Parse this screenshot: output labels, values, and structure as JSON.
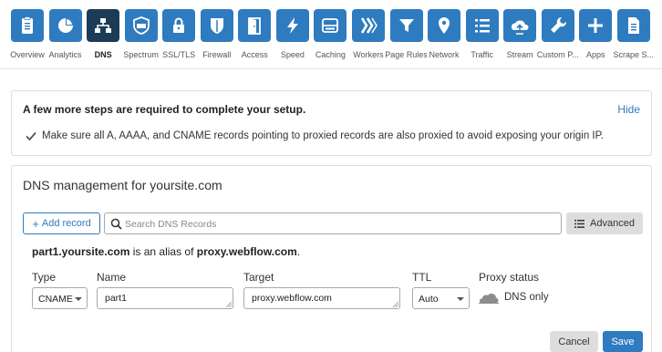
{
  "nav": {
    "active_index": 2,
    "items": [
      {
        "label": "Overview",
        "icon": "clipboard-icon"
      },
      {
        "label": "Analytics",
        "icon": "pie-chart-icon"
      },
      {
        "label": "DNS",
        "icon": "network-icon"
      },
      {
        "label": "Spectrum",
        "icon": "shield-card-icon"
      },
      {
        "label": "SSL/TLS",
        "icon": "lock-icon"
      },
      {
        "label": "Firewall",
        "icon": "firewall-shield-icon"
      },
      {
        "label": "Access",
        "icon": "door-icon"
      },
      {
        "label": "Speed",
        "icon": "lightning-icon"
      },
      {
        "label": "Caching",
        "icon": "server-icon"
      },
      {
        "label": "Workers",
        "icon": "workers-chevrons-icon"
      },
      {
        "label": "Page Rules",
        "icon": "filter-icon"
      },
      {
        "label": "Network",
        "icon": "location-pin-icon"
      },
      {
        "label": "Traffic",
        "icon": "list-icon"
      },
      {
        "label": "Stream",
        "icon": "cloud-upload-icon"
      },
      {
        "label": "Custom P...",
        "icon": "wrench-icon"
      },
      {
        "label": "Apps",
        "icon": "plus-icon"
      },
      {
        "label": "Scrape S...",
        "icon": "document-icon"
      }
    ]
  },
  "setup": {
    "title": "A few more steps are required to complete your setup.",
    "hide_label": "Hide",
    "message": "Make sure all A, AAAA, and CNAME records pointing to proxied records are also proxied to avoid exposing your origin IP."
  },
  "dns": {
    "title": "DNS management for yoursite.com",
    "add_record_label": "Add record",
    "search_placeholder": "Search DNS Records",
    "advanced_label": "Advanced",
    "alias": {
      "host": "part1.yoursite.com",
      "middle": " is an alias of ",
      "target": "proxy.webflow.com",
      "end": "."
    },
    "form": {
      "type_label": "Type",
      "type_value": "CNAME",
      "name_label": "Name",
      "name_value": "part1",
      "target_label": "Target",
      "target_value": "proxy.webflow.com",
      "ttl_label": "TTL",
      "ttl_value": "Auto",
      "proxy_label": "Proxy status",
      "proxy_value": "DNS only"
    },
    "cancel_label": "Cancel",
    "save_label": "Save"
  },
  "colors": {
    "nav_tile": "#2f7bbf",
    "nav_tile_active": "#1c3b57",
    "accent": "#2f7bbf",
    "button_gray": "#dddddd"
  }
}
